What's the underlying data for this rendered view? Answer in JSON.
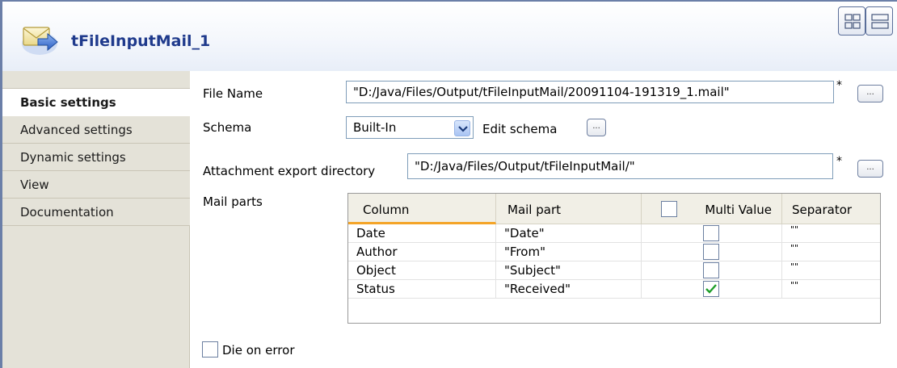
{
  "header": {
    "title": "tFileInputMail_1"
  },
  "sidebar": {
    "items": [
      {
        "label": "Basic settings",
        "active": true
      },
      {
        "label": "Advanced settings",
        "active": false
      },
      {
        "label": "Dynamic settings",
        "active": false
      },
      {
        "label": "View",
        "active": false
      },
      {
        "label": "Documentation",
        "active": false
      }
    ]
  },
  "form": {
    "file_name_label": "File Name",
    "file_name_value": "\"D:/Java/Files/Output/tFileInputMail/20091104-191319_1.mail\"",
    "schema_label": "Schema",
    "schema_value": "Built-In",
    "edit_schema_label": "Edit schema",
    "attachment_label": "Attachment export directory",
    "attachment_value": "\"D:/Java/Files/Output/tFileInputMail/\"",
    "mail_parts_label": "Mail parts",
    "required_marker": "*",
    "dots_label": "...",
    "die_on_error_label": "Die on error",
    "die_on_error_checked": false
  },
  "table": {
    "headers": [
      "Column",
      "Mail part",
      "Multi Value",
      "Separator"
    ],
    "rows": [
      {
        "column": "Date",
        "mail_part": "\"Date\"",
        "multi_value": false,
        "separator": "\"\""
      },
      {
        "column": "Author",
        "mail_part": "\"From\"",
        "multi_value": false,
        "separator": "\"\""
      },
      {
        "column": "Object",
        "mail_part": "\"Subject\"",
        "multi_value": false,
        "separator": "\"\""
      },
      {
        "column": "Status",
        "mail_part": "\"Received\"",
        "multi_value": true,
        "separator": "\"\""
      }
    ]
  },
  "icons": {
    "component": "mail-envelope-icon",
    "view_grid": "grid-view-icon",
    "view_list": "list-view-icon",
    "dropdown": "chevron-down-icon",
    "check": "check-icon"
  },
  "colors": {
    "title": "#1f3a8c",
    "sidebar_bg": "#e4e2d8",
    "active_column_underline": "#f4a428",
    "checkmark": "#1e9e2a"
  }
}
